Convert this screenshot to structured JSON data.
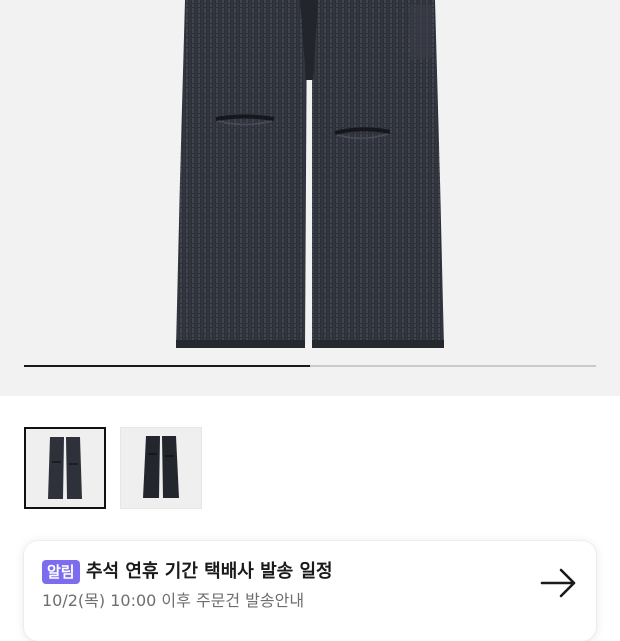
{
  "gallery": {
    "current_slide": 1,
    "total_slides": 2,
    "progress": 0.5,
    "thumbnails": [
      {
        "label": "product-front-thumbnail",
        "selected": true
      },
      {
        "label": "product-alt-thumbnail",
        "selected": false
      }
    ]
  },
  "notice": {
    "badge": "알림",
    "title": "추석 연휴 기간 택배사 발송 일정",
    "subtitle": "10/2(목) 10:00 이후 주문건 발송안내",
    "icon": "arrow-right-icon",
    "badge_color": "#7b6cf0"
  },
  "colors": {
    "background": "#f2f2f2",
    "product": "#2c2f38",
    "progress_active": "#1a1a1a",
    "progress_track": "#c9c9c9"
  }
}
